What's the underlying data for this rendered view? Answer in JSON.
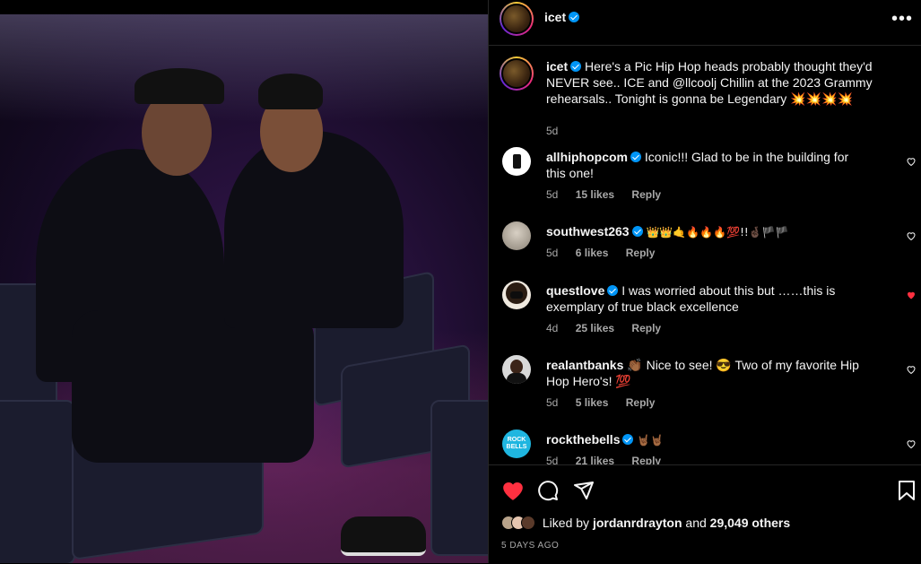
{
  "post": {
    "author": "icet",
    "verified": true,
    "more_icon": "more-horizontal-icon",
    "caption": "Here's a Pic Hip Hop heads probably thought they'd NEVER see.. ICE and @llcoolj Chillin at the 2023 Grammy rehearsals.. Tonight is gonna be Legendary 💥💥💥💥",
    "caption_age": "5d"
  },
  "comments": [
    {
      "user": "allhiphopcom",
      "text": "Iconic!!! Glad to be in the building for this one!",
      "age": "5d",
      "likes": "15 likes",
      "reply": "Reply",
      "liked": false
    },
    {
      "user": "southwest263",
      "text": "👑👑🤙🔥🔥🔥💯!!🤞🏿🏴🏴",
      "age": "5d",
      "likes": "6 likes",
      "reply": "Reply",
      "liked": false
    },
    {
      "user": "questlove",
      "text": "I was worried about this but ……this is exemplary of true black excellence",
      "age": "4d",
      "likes": "25 likes",
      "reply": "Reply",
      "liked": true
    },
    {
      "user": "realantbanks",
      "text": "👏🏾 Nice to see! 😎 Two of my favorite Hip Hop Hero's! 💯",
      "age": "5d",
      "likes": "5 likes",
      "reply": "Reply",
      "liked": false
    },
    {
      "user": "rockthebells",
      "text": "🤘🏾🤘🏾",
      "age": "5d",
      "likes": "21 likes",
      "reply": "Reply",
      "liked": false
    }
  ],
  "actions": {
    "like_icon": "heart-filled-icon",
    "comment_icon": "comment-icon",
    "share_icon": "share-icon",
    "save_icon": "bookmark-icon",
    "like_color": "#ff3040"
  },
  "likes": {
    "prefix": "Liked by",
    "user": "jordanrdrayton",
    "middle": "and",
    "count": "29,049 others"
  },
  "date": "5 DAYS AGO",
  "rockthebells_badge": "ROCK BELLS"
}
